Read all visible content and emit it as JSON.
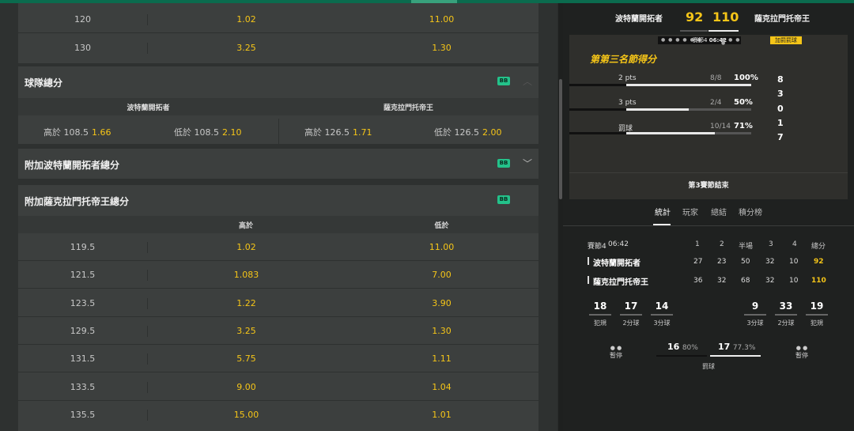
{
  "colors": {
    "accent": "#f5c518",
    "badge": "#23c28a",
    "top_bar": "#0b6b4e"
  },
  "top_rows": [
    {
      "line": "120",
      "over": "1.02",
      "under": "11.00"
    },
    {
      "line": "130",
      "over": "3.25",
      "under": "1.30"
    }
  ],
  "team_totals": {
    "title": "球隊總分",
    "badge": "BB",
    "team1": "波特蘭開拓者",
    "team2": "薩克拉門托帝王",
    "cells": [
      {
        "label": "高於 108.5",
        "odds": "1.66"
      },
      {
        "label": "低於 108.5",
        "odds": "2.10"
      },
      {
        "label": "高於 126.5",
        "odds": "1.71"
      },
      {
        "label": "低於 126.5",
        "odds": "2.00"
      }
    ]
  },
  "extra_blazers": {
    "title": "附加波特蘭開拓者總分",
    "badge": "BB",
    "chevron": "chevron-down-icon"
  },
  "extra_kings": {
    "title": "附加薩克拉門托帝王總分",
    "badge": "BB",
    "col_over": "高於",
    "col_under": "低於",
    "rows": [
      {
        "line": "119.5",
        "over": "1.02",
        "under": "11.00"
      },
      {
        "line": "121.5",
        "over": "1.083",
        "under": "7.00"
      },
      {
        "line": "123.5",
        "over": "1.22",
        "under": "3.90"
      },
      {
        "line": "129.5",
        "over": "3.25",
        "under": "1.30"
      },
      {
        "line": "131.5",
        "over": "5.75",
        "under": "1.11"
      },
      {
        "line": "133.5",
        "over": "9.00",
        "under": "1.04"
      },
      {
        "line": "135.5",
        "over": "15.00",
        "under": "1.01"
      }
    ]
  },
  "scoreboard": {
    "home_name": "波特蘭開拓者",
    "home_score": "92",
    "away_score": "110",
    "away_name": "薩克拉門托帝王",
    "quarter": "賽節4",
    "clock": "06:42",
    "penalty_badge": "加罰罰球",
    "panel_title": "第第三名節得分",
    "stats": [
      {
        "label": "2 pts",
        "frac": "8/8",
        "pct": "100%",
        "fill": 1.0
      },
      {
        "label": "3 pts",
        "frac": "2/4",
        "pct": "50%",
        "fill": 0.5
      },
      {
        "label": "罰球",
        "frac": "10/14",
        "pct": "71%",
        "fill": 0.71
      }
    ],
    "right_numbers": [
      "8",
      "3",
      "0",
      "1",
      "7"
    ],
    "end_text": "第3賽節結束"
  },
  "tabs": [
    "統計",
    "玩家",
    "總結",
    "積分榜"
  ],
  "box": {
    "header": [
      "賽節4",
      "06:42",
      "1",
      "2",
      "半場",
      "3",
      "4",
      "總分"
    ],
    "teams": [
      {
        "name": "波特蘭開拓者",
        "q": [
          "27",
          "23",
          "50",
          "32",
          "10"
        ],
        "total": "92"
      },
      {
        "name": "薩克拉門托帝王",
        "q": [
          "36",
          "32",
          "68",
          "32",
          "10"
        ],
        "total": "110"
      }
    ]
  },
  "team_stats": {
    "left": [
      {
        "n": "18",
        "l": "犯規"
      },
      {
        "n": "17",
        "l": "2分球"
      },
      {
        "n": "14",
        "l": "3分球"
      }
    ],
    "right": [
      {
        "n": "9",
        "l": "3分球"
      },
      {
        "n": "33",
        "l": "2分球"
      },
      {
        "n": "19",
        "l": "犯規"
      }
    ],
    "timeout_label": "暫停",
    "ft_left_n": "16",
    "ft_left_pct": "80%",
    "ft_right_n": "17",
    "ft_right_pct": "77.3%",
    "ft_label": "罰球"
  }
}
